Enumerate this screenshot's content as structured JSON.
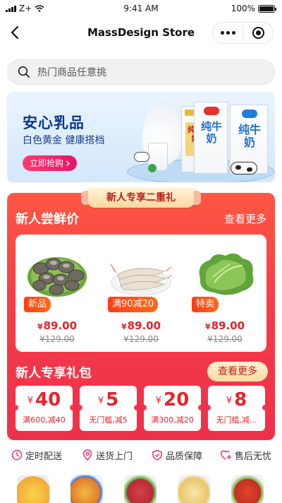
{
  "status_bar": {
    "carrier": "Z+",
    "time": "9:41 AM",
    "battery": "100%"
  },
  "nav": {
    "title": "MassDesign Store"
  },
  "search": {
    "placeholder": "热门商品任意挑"
  },
  "banner": {
    "title": "安心乳品",
    "subtitle": "白色黄金 健康搭档",
    "button": "立即抢购",
    "box1_text": "纯牛奶",
    "box2_text": "纯牛奶",
    "box3_text": "纯牛奶"
  },
  "promo": {
    "ribbon": "新人专享二重礼",
    "section1": {
      "title": "新人尝鲜价",
      "more": "查看更多"
    },
    "products": [
      {
        "badge": "新品",
        "currency": "¥",
        "price": "89.00",
        "original": "¥129.00",
        "icon": "clams-image"
      },
      {
        "badge": "满90减20",
        "currency": "¥",
        "price": "89.00",
        "original": "¥129.00",
        "icon": "shrimp-image"
      },
      {
        "badge": "特卖",
        "currency": "¥",
        "price": "89.00",
        "original": "¥129.00",
        "icon": "lettuce-image"
      }
    ],
    "section2": {
      "title": "新人专享礼包",
      "more": "查看更多"
    },
    "coupons": [
      {
        "currency": "¥",
        "amount": "40",
        "condition": "满600,减40"
      },
      {
        "currency": "¥",
        "amount": "5",
        "condition": "无门槛,减5"
      },
      {
        "currency": "¥",
        "amount": "20",
        "condition": "满300,减20"
      },
      {
        "currency": "¥",
        "amount": "8",
        "condition": "无门槛,减..."
      }
    ]
  },
  "services": [
    {
      "label": "定时配送",
      "icon": "clock-icon"
    },
    {
      "label": "送货上门",
      "icon": "location-pin-icon"
    },
    {
      "label": "品质保障",
      "icon": "shield-icon"
    },
    {
      "label": "售后无忧",
      "icon": "heart-plus-icon"
    }
  ],
  "colors": {
    "accent_red": "#f23a4a",
    "price_red": "#e8232b",
    "brand_pink": "#e4156a",
    "milk_blue": "#1c6fd1"
  }
}
